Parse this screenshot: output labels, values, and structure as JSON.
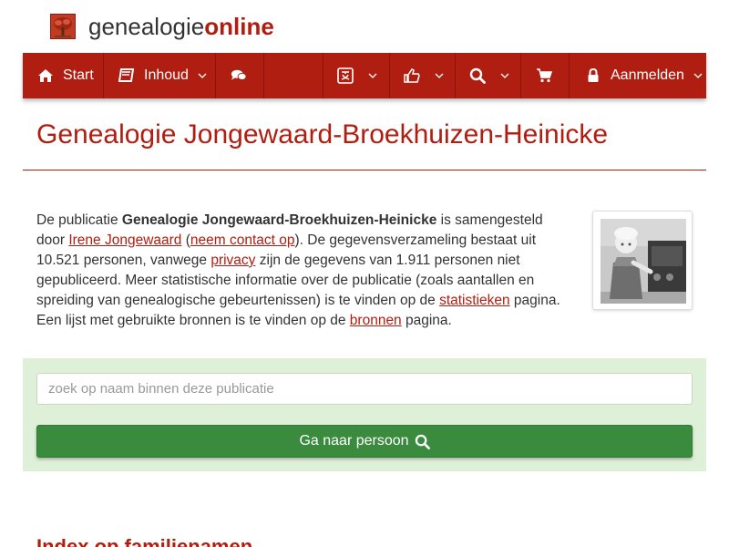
{
  "brand": {
    "part1": "genealogie",
    "part2": "online",
    "logo_icon": "tree-logo-icon"
  },
  "nav": {
    "items": [
      {
        "label": "Start",
        "icon": "home-icon"
      },
      {
        "label": "Inhoud",
        "icon": "book-icon"
      },
      {
        "label": "",
        "icon": "comments-icon"
      },
      {
        "label": "",
        "icon": "translate-icon"
      },
      {
        "label": "",
        "icon": "thumbs-up-icon"
      },
      {
        "label": "",
        "icon": "search-icon"
      },
      {
        "label": "",
        "icon": "shopping-cart-icon"
      },
      {
        "label": "Aanmelden",
        "icon": "lock-icon"
      }
    ]
  },
  "page": {
    "title": "Genealogie Jongewaard-Broekhuizen-Heinicke",
    "intro": {
      "t1": "De publicatie ",
      "pub_name": "Genealogie Jongewaard-Broekhuizen-Heinicke",
      "t2": " is samengesteld door ",
      "author": "Irene Jongewaard",
      "t3": " (",
      "contact": "neem contact op",
      "t4": "). De gegevensverzameling bestaat uit 10.521 personen, vanwege ",
      "privacy": "privacy",
      "t5": " zijn de gegevens van 1.911 personen niet gepubliceerd. Meer statistische informatie over de publicatie (zoals aantallen en spreiding van genealogische gebeurtenissen) is te vinden op de ",
      "stats": "statistieken",
      "t6": " pagina. Een lijst met gebruikte bronnen is te vinden op de ",
      "sources": "bronnen",
      "t7": " pagina."
    }
  },
  "search": {
    "placeholder": "zoek op naam binnen deze publicatie",
    "button_label": "Ga naar persoon",
    "button_icon": "search-icon"
  },
  "section": {
    "heading": "Index op familienamen"
  },
  "colors": {
    "brand_red": "#b01e11",
    "panel_green": "#dff0d8",
    "button_green": "#3a8b3e"
  }
}
